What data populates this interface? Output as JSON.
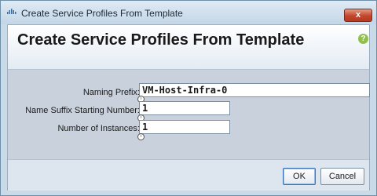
{
  "window": {
    "title": "Create Service Profiles From Template",
    "close_glyph": "x",
    "app_icon": "cisco-icon"
  },
  "header": {
    "title": "Create Service Profiles From Template",
    "help_icon": "help-icon",
    "help_glyph": "?"
  },
  "form": {
    "naming_prefix": {
      "label": "Naming Prefix:",
      "value": "VM-Host-Infra-0"
    },
    "suffix_start": {
      "label": "Name Suffix Starting Number:",
      "value": "1"
    },
    "instances": {
      "label": "Number of Instances:",
      "value": "1"
    },
    "info_glyph": "i"
  },
  "footer": {
    "ok_label": "OK",
    "cancel_label": "Cancel"
  },
  "colors": {
    "accent": "#3c76b5",
    "close_button": "#c0462c",
    "help_icon": "#8fc04a"
  }
}
